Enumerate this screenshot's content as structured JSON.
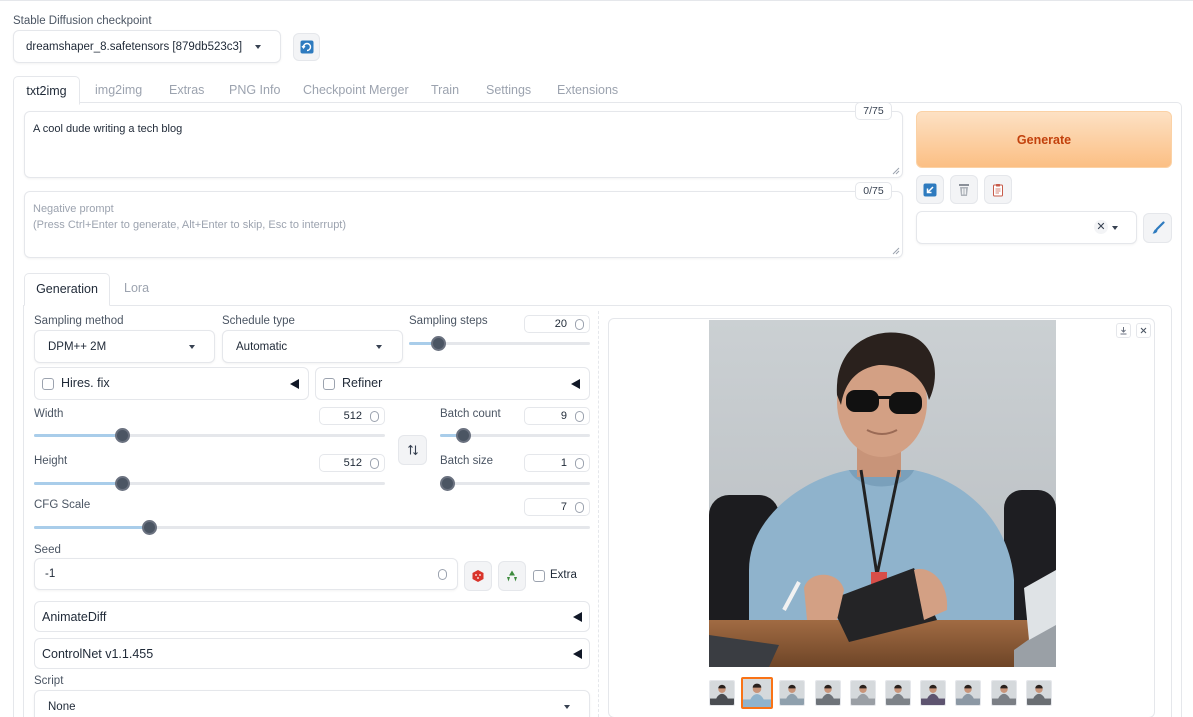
{
  "checkpoint": {
    "label": "Stable Diffusion checkpoint",
    "value": "dreamshaper_8.safetensors [879db523c3]"
  },
  "main_tabs": [
    "txt2img",
    "img2img",
    "Extras",
    "PNG Info",
    "Checkpoint Merger",
    "Train",
    "Settings",
    "Extensions"
  ],
  "prompt": {
    "value": "A cool dude writing a tech blog",
    "counter": "7/75"
  },
  "negative_prompt": {
    "placeholder_line1": "Negative prompt",
    "placeholder_line2": "(Press Ctrl+Enter to generate, Alt+Enter to skip, Esc to interrupt)",
    "counter": "0/75"
  },
  "generate_label": "Generate",
  "sub_tabs": [
    "Generation",
    "Lora"
  ],
  "sampling_method": {
    "label": "Sampling method",
    "value": "DPM++ 2M"
  },
  "schedule_type": {
    "label": "Schedule type",
    "value": "Automatic"
  },
  "sampling_steps": {
    "label": "Sampling steps",
    "value": "20",
    "level": 0.13
  },
  "hires_fix": "Hires. fix",
  "refiner": "Refiner",
  "width": {
    "label": "Width",
    "value": "512",
    "level": 0.24
  },
  "height": {
    "label": "Height",
    "value": "512",
    "level": 0.24
  },
  "batch_count": {
    "label": "Batch count",
    "value": "9",
    "level": 0.12
  },
  "batch_size": {
    "label": "Batch size",
    "value": "1",
    "level": 0.0
  },
  "cfg_scale": {
    "label": "CFG Scale",
    "value": "7",
    "level": 0.2
  },
  "seed": {
    "label": "Seed",
    "value": "-1",
    "extra_label": "Extra"
  },
  "animatediff": "AnimateDiff",
  "controlnet": "ControlNet v1.1.455",
  "script": {
    "label": "Script",
    "value": "None"
  },
  "gallery": {
    "selected_index": 1,
    "thumbnail_count": 10
  },
  "colors": {
    "generate_top": "#fde1c4",
    "generate_bottom": "#fbbf84",
    "generate_text": "#c2410c",
    "slider_fill": "#a9cdea"
  }
}
